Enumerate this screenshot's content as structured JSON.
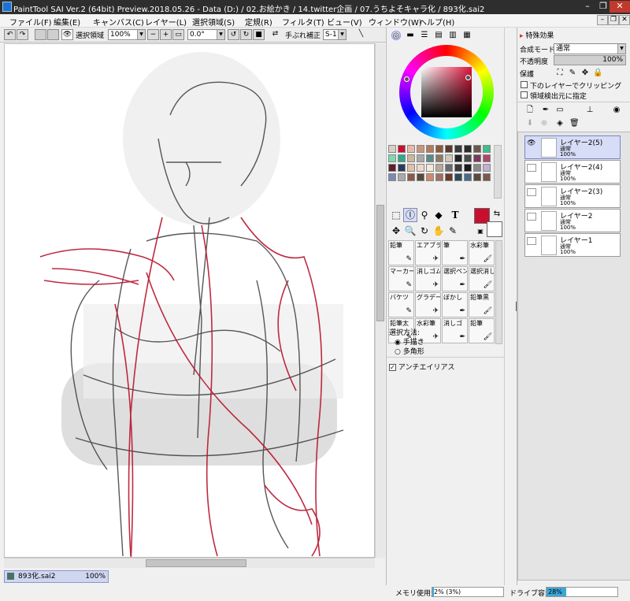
{
  "window": {
    "title": "PaintTool SAI Ver.2 (64bit) Preview.2018.05.26 - Data (D:) / 02.お絵かき / 14.twitter企画 / 07.うちよそキャラ化 / 893化.sai2"
  },
  "menu": [
    "ファイル(F)",
    "編集(E)",
    "キャンバス(C)",
    "レイヤー(L)",
    "選択領域(S)",
    "定規(R)",
    "フィルタ(T)",
    "ビュー(V)",
    "ウィンドウ(W)",
    "ヘルプ(H)"
  ],
  "toolbar": {
    "selection_label": "選択領域",
    "zoom": "100%",
    "rotation": "0.0°",
    "stabilizer_label": "手ぶれ補正",
    "stabilizer": "S-1"
  },
  "document_tab": {
    "name": "893化.sai2",
    "zoom": "100%"
  },
  "color_panel": {
    "selected_color": "#c8102e",
    "secondary_color": "#ffffff"
  },
  "palette": [
    "#d8cfc6",
    "#c8102e",
    "#e8b9a8",
    "#c8957a",
    "#b47a5a",
    "#8b5a3c",
    "#5a3a2a",
    "#3a3a3a",
    "#2a2a2a",
    "#6b5a4a",
    "#3cbf8a",
    "#7cd9b0",
    "#2fa88c",
    "#c9b89a",
    "#a8a8a8",
    "#5a8a8a",
    "#8c7a66",
    "#d0c8b8",
    "#222",
    "#4a4a4a",
    "#7a3a5a",
    "#aa4a6a",
    "#5a2030",
    "#2a3a5a",
    "#e0c0a8",
    "#f0d8c8",
    "#f8e8d8",
    "#b8a898",
    "#6a6a6a",
    "#3a3a3a",
    "#1a1a1a",
    "#8a8a8a",
    "#c0b0d0",
    "#7a8ab0",
    "#aaaaaa",
    "#8a5a4a",
    "#5a4a3a",
    "#d08a6a",
    "#a07060",
    "#6a3a2a",
    "#2e4a5a",
    "#4a6a8a",
    "#5a4a3a",
    "#7a5a4a"
  ],
  "tools": {
    "brushes": [
      [
        "鉛筆",
        "エアブラシ",
        "筆",
        "水彩筆"
      ],
      [
        "マーカー",
        "消しゴム",
        "選択ペン",
        "選択消し"
      ],
      [
        "バケツ",
        "グラデーション",
        "ぼかし",
        "鉛筆黒"
      ],
      [
        "鉛筆太",
        "水彩筆",
        "消しゴ",
        "鉛筆"
      ]
    ],
    "selection_method_label": "選択方法:",
    "selection_methods": [
      "手描き",
      "多角形"
    ],
    "antialias": "アンチエイリアス"
  },
  "layer_panel": {
    "header": "特殊効果",
    "blend_label": "合成モード",
    "blend": "通常",
    "opacity_label": "不透明度",
    "opacity": "100%",
    "protect_label": "保護",
    "clip": "下のレイヤーでクリッピング",
    "selsource": "領域検出元に指定",
    "layers": [
      {
        "name": "レイヤー2(5)",
        "mode": "通常",
        "opacity": "100%",
        "selected": true,
        "visible": true
      },
      {
        "name": "レイヤー2(4)",
        "mode": "通常",
        "opacity": "100%",
        "selected": false,
        "visible": false
      },
      {
        "name": "レイヤー2(3)",
        "mode": "通常",
        "opacity": "100%",
        "selected": false,
        "visible": false
      },
      {
        "name": "レイヤー2",
        "mode": "通常",
        "opacity": "100%",
        "selected": false,
        "visible": false
      },
      {
        "name": "レイヤー1",
        "mode": "通常",
        "opacity": "100%",
        "selected": false,
        "visible": false
      }
    ]
  },
  "status": {
    "memory_label": "メモリ使用量",
    "memory": "2% (3%)",
    "memory_fraction": 0.02,
    "drive_label": "ドライブ容量",
    "drive": "28%",
    "drive_fraction": 0.28
  }
}
